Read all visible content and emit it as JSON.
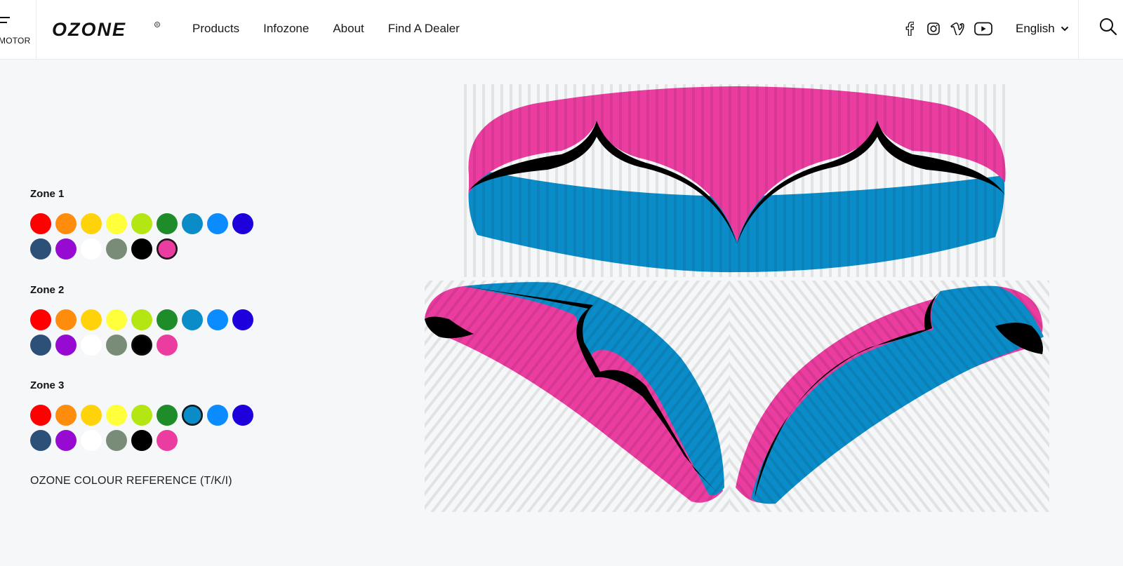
{
  "header": {
    "menu_label": "MOTOR",
    "logo_text": "OZONE",
    "nav": [
      "Products",
      "Infozone",
      "About",
      "Find A Dealer"
    ],
    "social_icons": [
      "facebook-icon",
      "instagram-icon",
      "vimeo-icon",
      "youtube-icon"
    ],
    "language": "English"
  },
  "palette": [
    "#ff0000",
    "#ff8c0c",
    "#ffd20a",
    "#ffff3c",
    "#b4e614",
    "#1e8c28",
    "#0a8cc8",
    "#0a8cff",
    "#1e00dc",
    "#2d5078",
    "#960ad2",
    "#ffffff",
    "#788c78",
    "#000000",
    "#eb3ca0"
  ],
  "zones": [
    {
      "title": "Zone 1",
      "selected": "#eb3ca0"
    },
    {
      "title": "Zone 2",
      "selected": "#000000"
    },
    {
      "title": "Zone 3",
      "selected": "#0a8cc8"
    }
  ],
  "reference_text": "OZONE COLOUR REFERENCE (T/K/I)",
  "colors": {
    "zone1": "#eb3ca0",
    "zone2": "#000000",
    "zone3": "#0a8cc8"
  }
}
